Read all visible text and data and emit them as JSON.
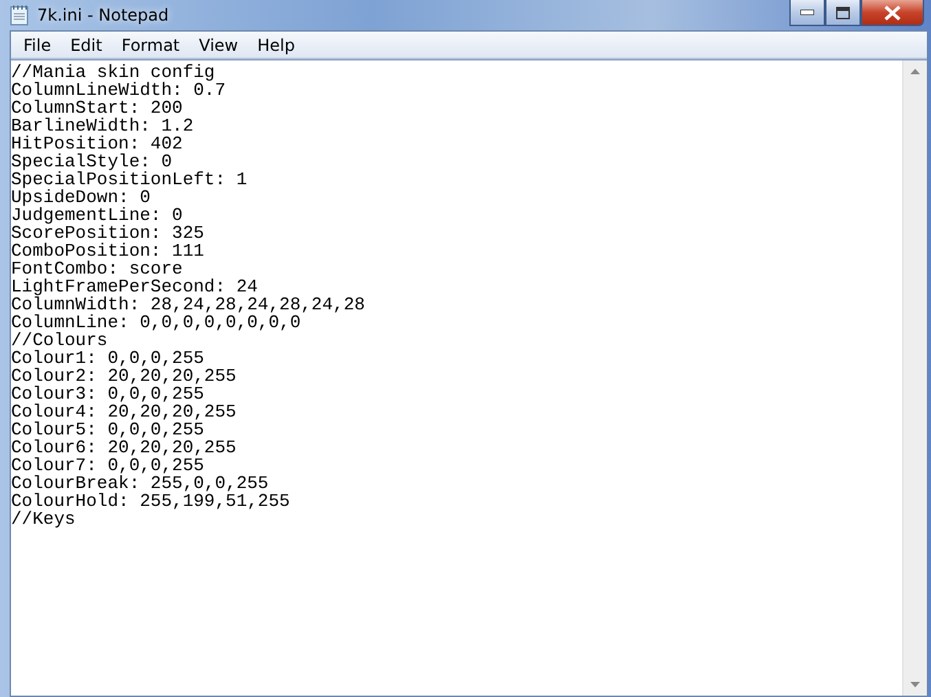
{
  "window": {
    "title": "7k.ini - Notepad"
  },
  "menu": [
    "File",
    "Edit",
    "Format",
    "View",
    "Help"
  ],
  "lines": [
    "//Mania skin config",
    "ColumnLineWidth: 0.7",
    "ColumnStart: 200",
    "BarlineWidth: 1.2",
    "HitPosition: 402",
    "SpecialStyle: 0",
    "SpecialPositionLeft: 1",
    "UpsideDown: 0",
    "JudgementLine: 0",
    "ScorePosition: 325",
    "ComboPosition: 111",
    "FontCombo: score",
    "LightFramePerSecond: 24",
    "ColumnWidth: 28,24,28,24,28,24,28",
    "ColumnLine: 0,0,0,0,0,0,0,0",
    "//Colours",
    "Colour1: 0,0,0,255",
    "Colour2: 20,20,20,255",
    "Colour3: 0,0,0,255",
    "Colour4: 20,20,20,255",
    "Colour5: 0,0,0,255",
    "Colour6: 20,20,20,255",
    "Colour7: 0,0,0,255",
    "ColourBreak: 255,0,0,255",
    "ColourHold: 255,199,51,255",
    "//Keys"
  ]
}
